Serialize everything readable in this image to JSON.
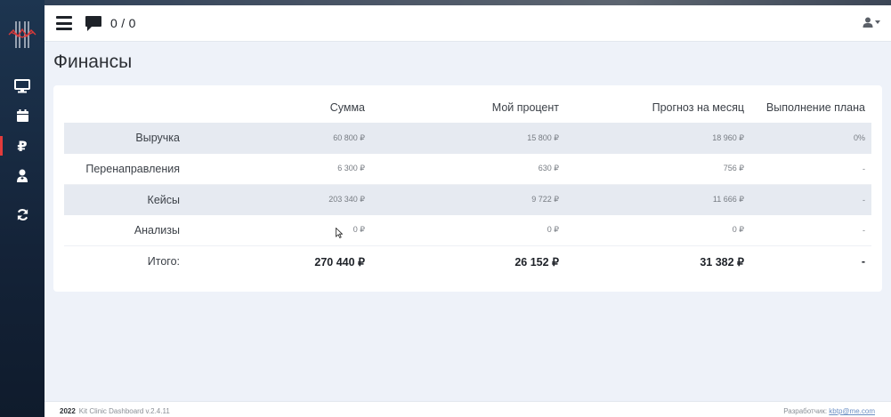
{
  "header": {
    "chat_count": "0 / 0"
  },
  "page": {
    "title": "Финансы"
  },
  "finance_table": {
    "columns": [
      "",
      "Сумма",
      "Мой процент",
      "Прогноз на месяц",
      "Выполнение плана"
    ],
    "rows": [
      {
        "label": "Выручка",
        "sum": "60 800 ₽",
        "percent": "15 800 ₽",
        "forecast": "18 960 ₽",
        "plan": "0%"
      },
      {
        "label": "Перенаправления",
        "sum": "6 300 ₽",
        "percent": "630 ₽",
        "forecast": "756 ₽",
        "plan": "-"
      },
      {
        "label": "Кейсы",
        "sum": "203 340 ₽",
        "percent": "9 722 ₽",
        "forecast": "11 666 ₽",
        "plan": "-"
      },
      {
        "label": "Анализы",
        "sum": "0 ₽",
        "percent": "0 ₽",
        "forecast": "0 ₽",
        "plan": "-"
      }
    ],
    "total": {
      "label": "Итого:",
      "sum": "270 440 ₽",
      "percent": "26 152 ₽",
      "forecast": "31 382 ₽",
      "plan": "-"
    }
  },
  "sidebar": {
    "items": [
      {
        "icon": "monitor-icon"
      },
      {
        "icon": "calendar-icon"
      },
      {
        "icon": "ruble-icon",
        "active": true
      },
      {
        "icon": "doctor-icon"
      },
      {
        "icon": "sync-icon"
      }
    ],
    "accent_color": "#e23b3b"
  },
  "footer": {
    "year": "2022",
    "app_name": "Kit Clinic Dashboard v.2.4.11",
    "developer_label": "Разработчик:",
    "developer_link": "kbtp@me.com"
  }
}
